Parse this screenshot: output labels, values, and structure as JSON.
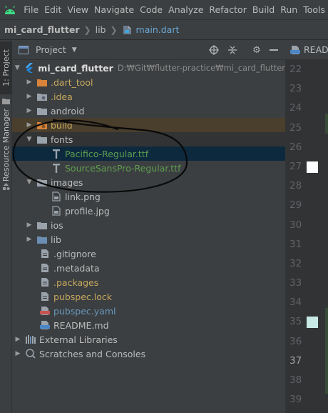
{
  "menu": {
    "items": [
      {
        "label": "File"
      },
      {
        "label": "Edit"
      },
      {
        "label": "View"
      },
      {
        "label": "Navigate"
      },
      {
        "label": "Code"
      },
      {
        "label": "Analyze"
      },
      {
        "label": "Refactor"
      },
      {
        "label": "Build"
      },
      {
        "label": "Run"
      },
      {
        "label": "Tools"
      }
    ]
  },
  "breadcrumb": {
    "project": "mi_card_flutter",
    "folder": "lib",
    "file": "main.dart"
  },
  "toolstrip": {
    "project_tab": "1: Project",
    "resource_tab": "Resource Manager"
  },
  "panel": {
    "title": "Project"
  },
  "tree": {
    "root_name": "mi_card_flutter",
    "root_path": "D:₩Git₩flutter-practice₩mi_card_flutter",
    "items": [
      {
        "label": ".dart_tool"
      },
      {
        "label": ".idea"
      },
      {
        "label": "android"
      },
      {
        "label": "build"
      },
      {
        "label": "fonts"
      },
      {
        "label": "Pacifico-Regular.ttf"
      },
      {
        "label": "SourceSansPro-Regular.ttf"
      },
      {
        "label": "images"
      },
      {
        "label": "link.png"
      },
      {
        "label": "profile.jpg"
      },
      {
        "label": "ios"
      },
      {
        "label": "lib"
      },
      {
        "label": ".gitignore"
      },
      {
        "label": ".metadata"
      },
      {
        "label": ".packages"
      },
      {
        "label": "pubspec.lock"
      },
      {
        "label": "pubspec.yaml"
      },
      {
        "label": "README.md"
      },
      {
        "label": "External Libraries"
      },
      {
        "label": "Scratches and Consoles"
      }
    ]
  },
  "editor": {
    "tab_label": "READ",
    "line_numbers": [
      "22",
      "23",
      "24",
      "25",
      "26",
      "27",
      "28",
      "29",
      "30",
      "31",
      "32",
      "33",
      "34",
      "35",
      "36",
      "37",
      "38",
      "39"
    ],
    "current_line": "37"
  },
  "colors": {
    "ignored": "#c6a75d",
    "added": "#5d9e50",
    "modified": "#6897bb",
    "selection": "#0d293e",
    "swatch_white": "#ffffff",
    "swatch_mint": "#c8eae6"
  }
}
